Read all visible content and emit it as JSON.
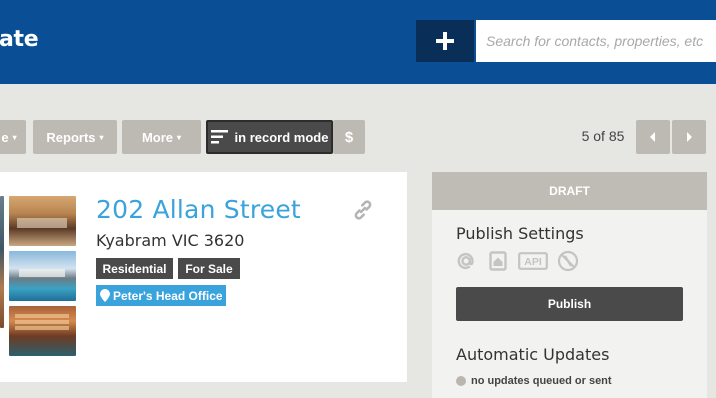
{
  "header": {
    "title": "ate",
    "add_icon": "plus-icon",
    "search_placeholder": "Search for contacts, properties, etc"
  },
  "toolbar": {
    "cut_label": "e",
    "reports_label": "Reports",
    "more_label": "More",
    "record_mode_label": "in record mode",
    "record_mode_icon": "list-icon",
    "dollar_label": "$",
    "caret": "▾"
  },
  "pager": {
    "text": "5 of 85",
    "prev_icon": "chevron-left-icon",
    "next_icon": "chevron-right-icon"
  },
  "property": {
    "title": "202 Allan Street",
    "suburb": "Kyabram VIC 3620",
    "tags": [
      "Residential",
      "For Sale"
    ],
    "office": "Peter's Head Office",
    "office_icon": "map-pin-icon",
    "link_icon": "link-icon"
  },
  "panel": {
    "status": "DRAFT",
    "publish_settings_heading": "Publish Settings",
    "publish_icons": [
      "email-icon",
      "website-icon",
      "api-icon",
      "disabled-portal-icon"
    ],
    "api_label": "API",
    "publish_button": "Publish",
    "automatic_updates_heading": "Automatic Updates",
    "updates_status": "no updates queued or sent"
  },
  "colors": {
    "header_bg": "#0a4f95",
    "accent_blue": "#3aa3dc",
    "dark_button": "#4a4a4a",
    "light_button": "#bdb9b3"
  }
}
